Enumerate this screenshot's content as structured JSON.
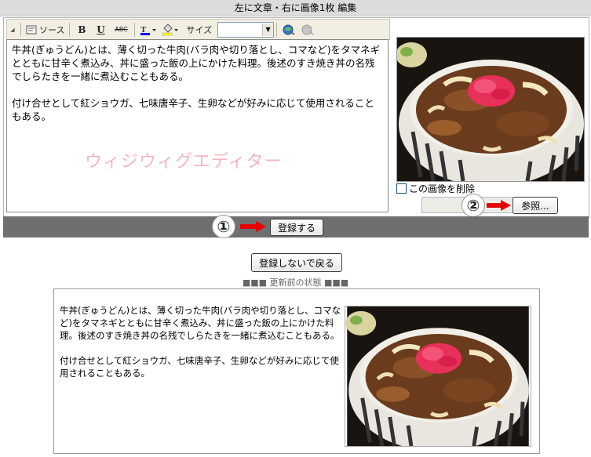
{
  "title": "左に文章・右に画像1枚 編集",
  "toolbar": {
    "source_label": "ソース",
    "bold_label": "B",
    "underline_label": "U",
    "strike_label": "ABC",
    "size_label": "サイズ",
    "size_value": ""
  },
  "editor": {
    "paragraph1": "牛丼(ぎゅうどん)とは、薄く切った牛肉(バラ肉や切り落とし、コマなど)をタマネギとともに甘辛く煮込み、丼に盛った飯の上にかけた料理。後述のすき焼き丼の名残でしらたきを一緒に煮込むこともある。",
    "paragraph2": "付け合せとして紅ショウガ、七味唐辛子、生卵などが好みに応じて使用されることもある。",
    "watermark": "ウィジウィグエディター"
  },
  "image_panel": {
    "delete_label": "この画像を削除",
    "browse_label": "参照..."
  },
  "markers": {
    "one": "①",
    "two": "②"
  },
  "register_label": "登録する",
  "back_label": "登録しないで戻る",
  "state_label": "■■■ 更新前の状態 ■■■",
  "preview": {
    "paragraph1": "牛丼(ぎゅうどん)とは、薄く切った牛肉(バラ肉や切り落とし、コマなど)をタマネギとともに甘辛く煮込み、丼に盛った飯の上にかけた料理。後述のすき焼き丼の名残でしらたきを一緒に煮込むこともある。",
    "paragraph2": "付け合せとして紅ショウガ、七味唐辛子、生卵などが好みに応じて使用されることもある。"
  },
  "colors": {
    "arrow": "#e60000",
    "watermark": "#f3b7c0",
    "gray_bar": "#6f6f6f"
  }
}
